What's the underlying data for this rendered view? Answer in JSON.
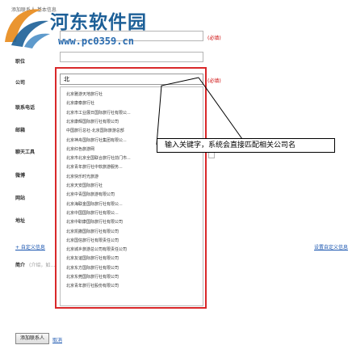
{
  "header": {
    "title": "添加联系人 基本信息"
  },
  "watermark": {
    "title": "河东软件园",
    "url": "www.pc0359.cn",
    "logo_icon": "river-swirl-logo-icon",
    "colors": {
      "blue": "#1c5f97",
      "orange": "#e88a1a"
    }
  },
  "form": {
    "required_label": "(必填)",
    "fields": {
      "position": {
        "label": "职位"
      },
      "company": {
        "label": "公司",
        "value": "北"
      },
      "phone": {
        "label": "联系电话"
      },
      "mail": {
        "label": "邮箱"
      },
      "im": {
        "label": "聊天工具"
      },
      "weibo": {
        "label": "微博"
      },
      "website": {
        "label": "网站"
      },
      "address": {
        "label": "地址"
      }
    },
    "custom_link": "+ 自定义信息",
    "settings_link": "设置自定义信息",
    "intro": {
      "label": "简介",
      "placeholder": "(介绍，如…"
    }
  },
  "suggestions": [
    "北京雅游天地旅行社",
    "北京康泰旅行社",
    "北京市工业展日国际旅行社有限公...",
    "北京康辉国际旅行社有限公司",
    "中国旅行总社-北京国际旅游总部",
    "北京神舟国际旅行社集团有限公...",
    "北京红色旅游网",
    "北京市北京全国联合旅行社前门市...",
    "北京青年旅行社中软旅游服务...",
    "北京快乐时光旅游",
    "北京天安国际旅行社",
    "北京中青国际旅游有限公司",
    "北京海联金国际旅行社有限公...",
    "北京中国国际旅行社有限公...",
    "北京中职康国际旅行社有限公司",
    "北京凯撒国际旅行社有限公司",
    "北京国信旅行社有限责任公司",
    "北京城乡旅游总公司有限责任公司",
    "北京友谊国际旅行社有限公司",
    "北京东方国际旅行社有限公司",
    "北京东莞国际旅行社有限公司",
    "北京青年旅行社股份有限公司"
  ],
  "callout": {
    "text": "输入关键字，系统会直接匹配相关公司名"
  },
  "buttons": {
    "add_contact": "添加联系人",
    "cancel": "取消"
  },
  "colors": {
    "highlight": "#d9282a",
    "link": "#1a56b0",
    "required": "#cc0000"
  }
}
